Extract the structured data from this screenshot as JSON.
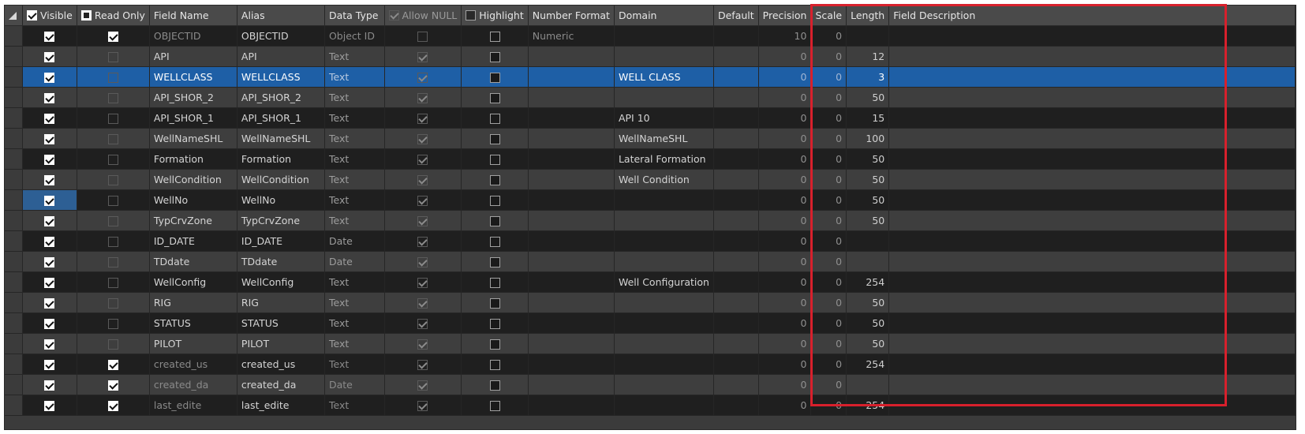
{
  "columns": {
    "visible": "Visible",
    "read_only": "Read Only",
    "field_name": "Field Name",
    "alias": "Alias",
    "data_type": "Data Type",
    "allow_null": "Allow NULL",
    "highlight": "Highlight",
    "number_format": "Number Format",
    "domain": "Domain",
    "default": "Default",
    "precision": "Precision",
    "scale": "Scale",
    "length": "Length",
    "field_description": "Field Description"
  },
  "rows": [
    {
      "visible": true,
      "read_only": true,
      "name": "OBJECTID",
      "alias": "OBJECTID",
      "type": "Object ID",
      "allow_null": false,
      "highlight": false,
      "number_format": "Numeric",
      "domain": "",
      "default": "",
      "precision": "10",
      "scale": "0",
      "length": "",
      "description": "",
      "dim": true
    },
    {
      "visible": true,
      "read_only": false,
      "name": "API",
      "alias": "API",
      "type": "Text",
      "allow_null": true,
      "highlight": false,
      "number_format": "",
      "domain": "",
      "default": "",
      "precision": "0",
      "scale": "0",
      "length": "12",
      "description": "",
      "dim": false
    },
    {
      "visible": true,
      "read_only": false,
      "name": "WELLCLASS",
      "alias": "WELLCLASS",
      "type": "Text",
      "allow_null": true,
      "highlight": false,
      "number_format": "",
      "domain": "WELL CLASS",
      "default": "",
      "precision": "0",
      "scale": "0",
      "length": "3",
      "description": "",
      "dim": false,
      "selected": true
    },
    {
      "visible": true,
      "read_only": false,
      "name": "API_SHOR_2",
      "alias": "API_SHOR_2",
      "type": "Text",
      "allow_null": true,
      "highlight": false,
      "number_format": "",
      "domain": "",
      "default": "",
      "precision": "0",
      "scale": "0",
      "length": "50",
      "description": "",
      "dim": false
    },
    {
      "visible": true,
      "read_only": false,
      "name": "API_SHOR_1",
      "alias": "API_SHOR_1",
      "type": "Text",
      "allow_null": true,
      "highlight": false,
      "number_format": "",
      "domain": "API 10",
      "default": "",
      "precision": "0",
      "scale": "0",
      "length": "15",
      "description": "",
      "dim": false
    },
    {
      "visible": true,
      "read_only": false,
      "name": "WellNameSHL",
      "alias": "WellNameSHL",
      "type": "Text",
      "allow_null": true,
      "highlight": false,
      "number_format": "",
      "domain": "WellNameSHL",
      "default": "",
      "precision": "0",
      "scale": "0",
      "length": "100",
      "description": "",
      "dim": false
    },
    {
      "visible": true,
      "read_only": false,
      "name": "Formation",
      "alias": "Formation",
      "type": "Text",
      "allow_null": true,
      "highlight": false,
      "number_format": "",
      "domain": "Lateral Formation",
      "default": "",
      "precision": "0",
      "scale": "0",
      "length": "50",
      "description": "",
      "dim": false
    },
    {
      "visible": true,
      "read_only": false,
      "name": "WellCondition",
      "alias": "WellCondition",
      "type": "Text",
      "allow_null": true,
      "highlight": false,
      "number_format": "",
      "domain": "Well Condition",
      "default": "",
      "precision": "0",
      "scale": "0",
      "length": "50",
      "description": "",
      "dim": false
    },
    {
      "visible": true,
      "read_only": false,
      "name": "WellNo",
      "alias": "WellNo",
      "type": "Text",
      "allow_null": true,
      "highlight": false,
      "number_format": "",
      "domain": "",
      "default": "",
      "precision": "0",
      "scale": "0",
      "length": "50",
      "description": "",
      "dim": false,
      "focus_visible": true
    },
    {
      "visible": true,
      "read_only": false,
      "name": "TypCrvZone",
      "alias": "TypCrvZone",
      "type": "Text",
      "allow_null": true,
      "highlight": false,
      "number_format": "",
      "domain": "",
      "default": "",
      "precision": "0",
      "scale": "0",
      "length": "50",
      "description": "",
      "dim": false
    },
    {
      "visible": true,
      "read_only": false,
      "name": "ID_DATE",
      "alias": "ID_DATE",
      "type": "Date",
      "allow_null": true,
      "highlight": false,
      "number_format": "",
      "domain": "",
      "default": "",
      "precision": "0",
      "scale": "0",
      "length": "",
      "description": "",
      "dim": false
    },
    {
      "visible": true,
      "read_only": false,
      "name": "TDdate",
      "alias": "TDdate",
      "type": "Date",
      "allow_null": true,
      "highlight": false,
      "number_format": "",
      "domain": "",
      "default": "",
      "precision": "0",
      "scale": "0",
      "length": "",
      "description": "",
      "dim": false
    },
    {
      "visible": true,
      "read_only": false,
      "name": "WellConfig",
      "alias": "WellConfig",
      "type": "Text",
      "allow_null": true,
      "highlight": false,
      "number_format": "",
      "domain": "Well Configuration",
      "default": "",
      "precision": "0",
      "scale": "0",
      "length": "254",
      "description": "",
      "dim": false
    },
    {
      "visible": true,
      "read_only": false,
      "name": "RIG",
      "alias": "RIG",
      "type": "Text",
      "allow_null": true,
      "highlight": false,
      "number_format": "",
      "domain": "",
      "default": "",
      "precision": "0",
      "scale": "0",
      "length": "50",
      "description": "",
      "dim": false
    },
    {
      "visible": true,
      "read_only": false,
      "name": "STATUS",
      "alias": "STATUS",
      "type": "Text",
      "allow_null": true,
      "highlight": false,
      "number_format": "",
      "domain": "",
      "default": "",
      "precision": "0",
      "scale": "0",
      "length": "50",
      "description": "",
      "dim": false
    },
    {
      "visible": true,
      "read_only": false,
      "name": "PILOT",
      "alias": "PILOT",
      "type": "Text",
      "allow_null": true,
      "highlight": false,
      "number_format": "",
      "domain": "",
      "default": "",
      "precision": "0",
      "scale": "0",
      "length": "50",
      "description": "",
      "dim": false
    },
    {
      "visible": true,
      "read_only": true,
      "name": "created_us",
      "alias": "created_us",
      "type": "Text",
      "allow_null": true,
      "highlight": false,
      "number_format": "",
      "domain": "",
      "default": "",
      "precision": "0",
      "scale": "0",
      "length": "254",
      "description": "",
      "dim": true
    },
    {
      "visible": true,
      "read_only": true,
      "name": "created_da",
      "alias": "created_da",
      "type": "Date",
      "allow_null": true,
      "highlight": false,
      "number_format": "",
      "domain": "",
      "default": "",
      "precision": "0",
      "scale": "0",
      "length": "",
      "description": "",
      "dim": true
    },
    {
      "visible": true,
      "read_only": true,
      "name": "last_edite",
      "alias": "last_edite",
      "type": "Text",
      "allow_null": true,
      "highlight": false,
      "number_format": "",
      "domain": "",
      "default": "",
      "precision": "0",
      "scale": "0",
      "length": "254",
      "description": "",
      "dim": true
    }
  ],
  "colors": {
    "selection": "#1e5fa6",
    "highlight_box": "#d8202c",
    "background": "#3b3b3b"
  }
}
